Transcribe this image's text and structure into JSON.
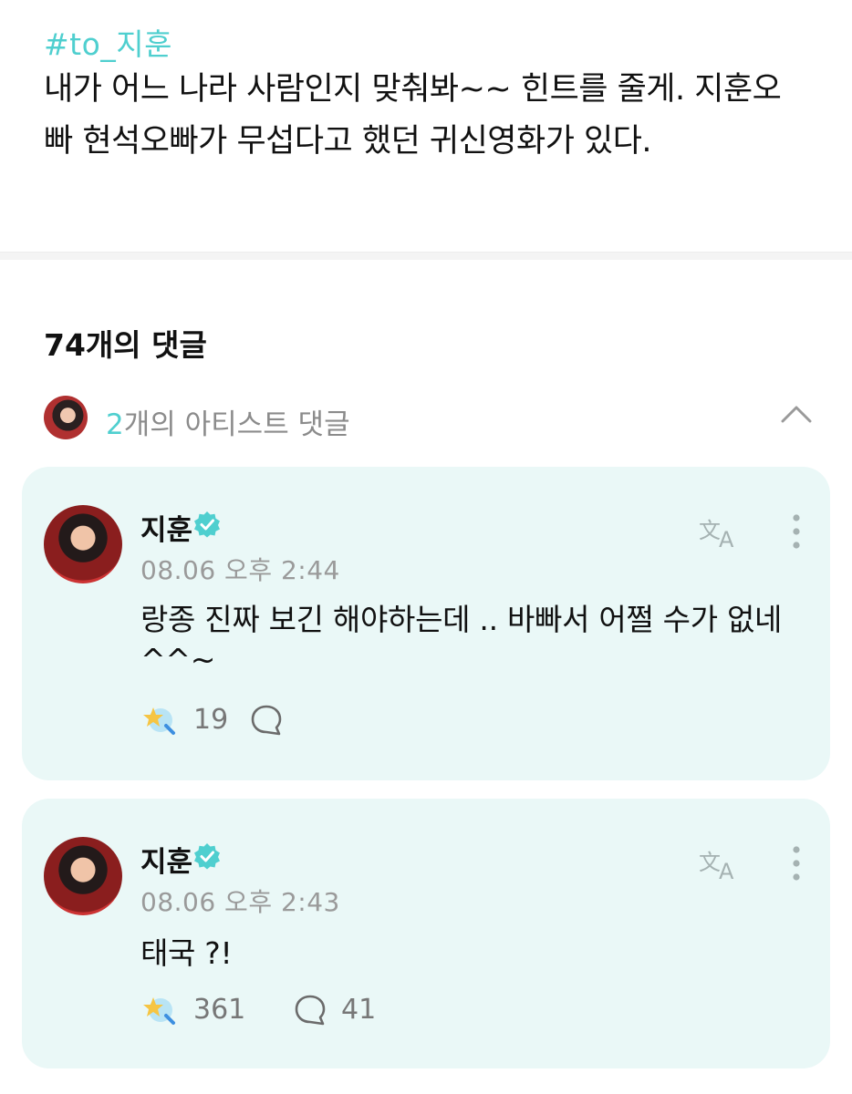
{
  "post": {
    "hashtag": "#to_지훈",
    "body": "내가 어느 나라 사람인지 맞춰봐~~ 힌트를 줄게.  지훈오빠 현석오빠가 무섭다고 했던 귀신영화가 있다."
  },
  "comments_header": {
    "count_label": "74개의 댓글"
  },
  "artist_comments": {
    "count": "2",
    "label": "개의 아티스트 댓글"
  },
  "comments": [
    {
      "author": "지훈",
      "time": "08.06 오후 2:44",
      "text": "랑종 진짜 보긴 해야하는데 .. 바빠서 어쩔 수가 없네 ^^~",
      "likes": "19",
      "replies": ""
    },
    {
      "author": "지훈",
      "time": "08.06 오후 2:43",
      "text": "태국 ?!",
      "likes": "361",
      "replies": "41"
    }
  ],
  "icons": {
    "verified": "verified-badge-icon",
    "translate": "translate-icon",
    "more": "more-vertical-icon",
    "like": "star-heart-icon",
    "reply": "speech-bubble-icon",
    "collapse": "chevron-up-icon"
  },
  "colors": {
    "accent": "#4fcfcf",
    "card_bg": "#eaf8f7"
  }
}
